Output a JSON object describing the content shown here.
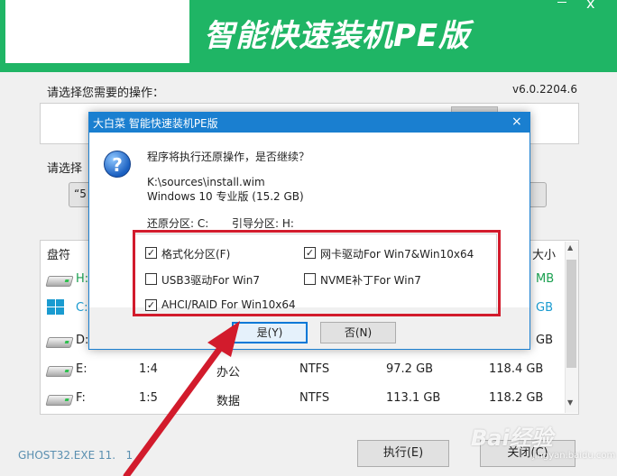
{
  "header": {
    "app_title": "智能快速装机PE版",
    "close_glyph": "x"
  },
  "main": {
    "section1_label": "请选择您需要的操作：",
    "version": "v6.0.2204.6",
    "section2_label": "请选择",
    "bar2_partial": "“5"
  },
  "table": {
    "headers": [
      "盘符",
      "大小"
    ],
    "rows": [
      {
        "drive": "H:",
        "size_partial": "MB",
        "color": "#1aa050"
      },
      {
        "drive": "C:",
        "size_partial": "GB",
        "color": "#1a9bd0"
      },
      {
        "drive": "D:",
        "size_partial": "GB",
        "color": "#222222"
      },
      {
        "drive": "E:",
        "index": "1:4",
        "label": "办公",
        "fs": "NTFS",
        "free": "97.2 GB",
        "total": "118.4 GB",
        "color": "#222222"
      },
      {
        "drive": "F:",
        "index": "1:5",
        "label": "数据",
        "fs": "NTFS",
        "free": "113.1 GB",
        "total": "118.2 GB",
        "color": "#222222"
      }
    ]
  },
  "footer": {
    "ghost_text": "GHOST32.EXE 11.",
    "ghost_suffix": "1",
    "execute_button": "执行(E)",
    "close_button": "关闭(C)",
    "watermark": "Bai经验",
    "watermark_sub": "jingyan.baidu.com"
  },
  "dialog": {
    "title": "大白菜 智能快速装机PE版",
    "close_glyph": "×",
    "icon_glyph": "?",
    "question": "程序将执行还原操作，是否继续？",
    "source_path": "K:\\sources\\install.wim",
    "image_name": "Windows 10 专业版 (15.2 GB)",
    "restore_partition": "还原分区: C:",
    "boot_partition": "引导分区: H:",
    "options": [
      {
        "label": "格式化分区(F)",
        "checked": true
      },
      {
        "label": "网卡驱动For Win7&Win10x64",
        "checked": true
      },
      {
        "label": "USB3驱动For Win7",
        "checked": false
      },
      {
        "label": "NVME补丁For Win7",
        "checked": false
      },
      {
        "label": "AHCI/RAID For Win10x64",
        "checked": true
      }
    ],
    "yes_button": "是(Y)",
    "no_button": "否(N)",
    "check_glyph": "✓"
  },
  "colors": {
    "header_green": "#1fb565",
    "dialog_title_blue": "#1a7fd0",
    "highlight_red": "#d21b2c"
  }
}
